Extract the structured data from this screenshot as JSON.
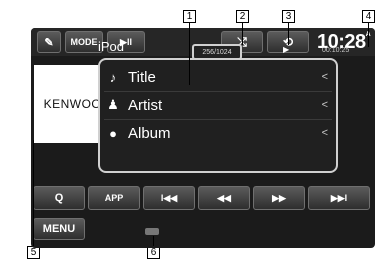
{
  "top_bar": {
    "mode_label": "MODE",
    "play_pause_glyph": "▶II",
    "shuffle_glyph": "⤮",
    "repeat_glyph": "⟲",
    "clock_time": "10:28",
    "clock_suffix": "A"
  },
  "now_playing": {
    "source": "iPod",
    "track_count": "256/1024",
    "play_indicator": "▶",
    "elapsed_time": "00:10:25",
    "artwork_text": "KENWOOD"
  },
  "info_rows": [
    {
      "icon": "♪",
      "label": "Title",
      "chevron": "<"
    },
    {
      "icon": "♟",
      "label": "Artist",
      "chevron": "<"
    },
    {
      "icon": "●",
      "label": "Album",
      "chevron": "<"
    }
  ],
  "control_bar": {
    "search_glyph": "Q",
    "app_label": "APP",
    "prev_track_glyph": "I◀◀",
    "rewind_glyph": "◀◀",
    "forward_glyph": "▶▶",
    "next_track_glyph": "▶▶I"
  },
  "bottom": {
    "menu_label": "MENU"
  },
  "callouts": [
    "1",
    "2",
    "3",
    "4",
    "5",
    "6"
  ],
  "colors": {
    "screen_bg": "#1b1b1b",
    "button_gradient_top": "#5b5b5b",
    "button_gradient_bottom": "#2e2e2e",
    "panel_border": "#d0d0d0"
  }
}
